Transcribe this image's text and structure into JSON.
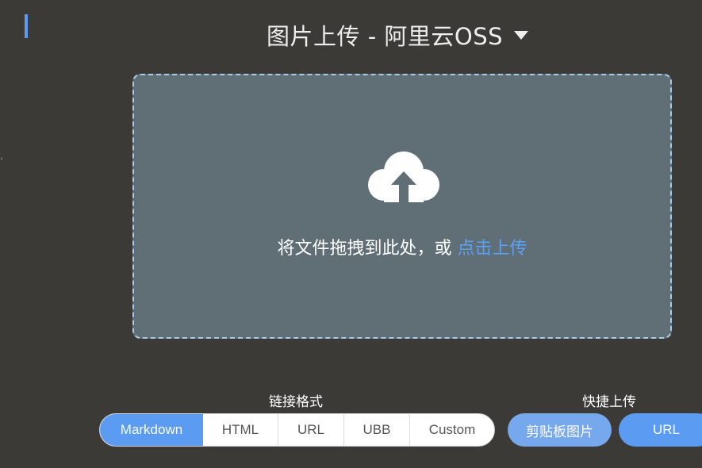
{
  "header": {
    "title": "图片上传 - 阿里云OSS",
    "dropdown_icon": "caret-down-icon"
  },
  "dropzone": {
    "icon": "cloud-upload-icon",
    "text": "将文件拖拽到此处，或 ",
    "link": "点击上传"
  },
  "link_format": {
    "label": "链接格式",
    "options": [
      "Markdown",
      "HTML",
      "URL",
      "UBB",
      "Custom"
    ],
    "selected": "Markdown"
  },
  "quick_upload": {
    "label": "快捷上传",
    "clipboard": "剪贴板图片",
    "url": "URL"
  },
  "colors": {
    "background": "#3b3a36",
    "accent": "#5b9bf2",
    "dropzone_fill": "#606e75",
    "dropzone_border": "#a7cdea",
    "link": "#5aa0f5"
  }
}
